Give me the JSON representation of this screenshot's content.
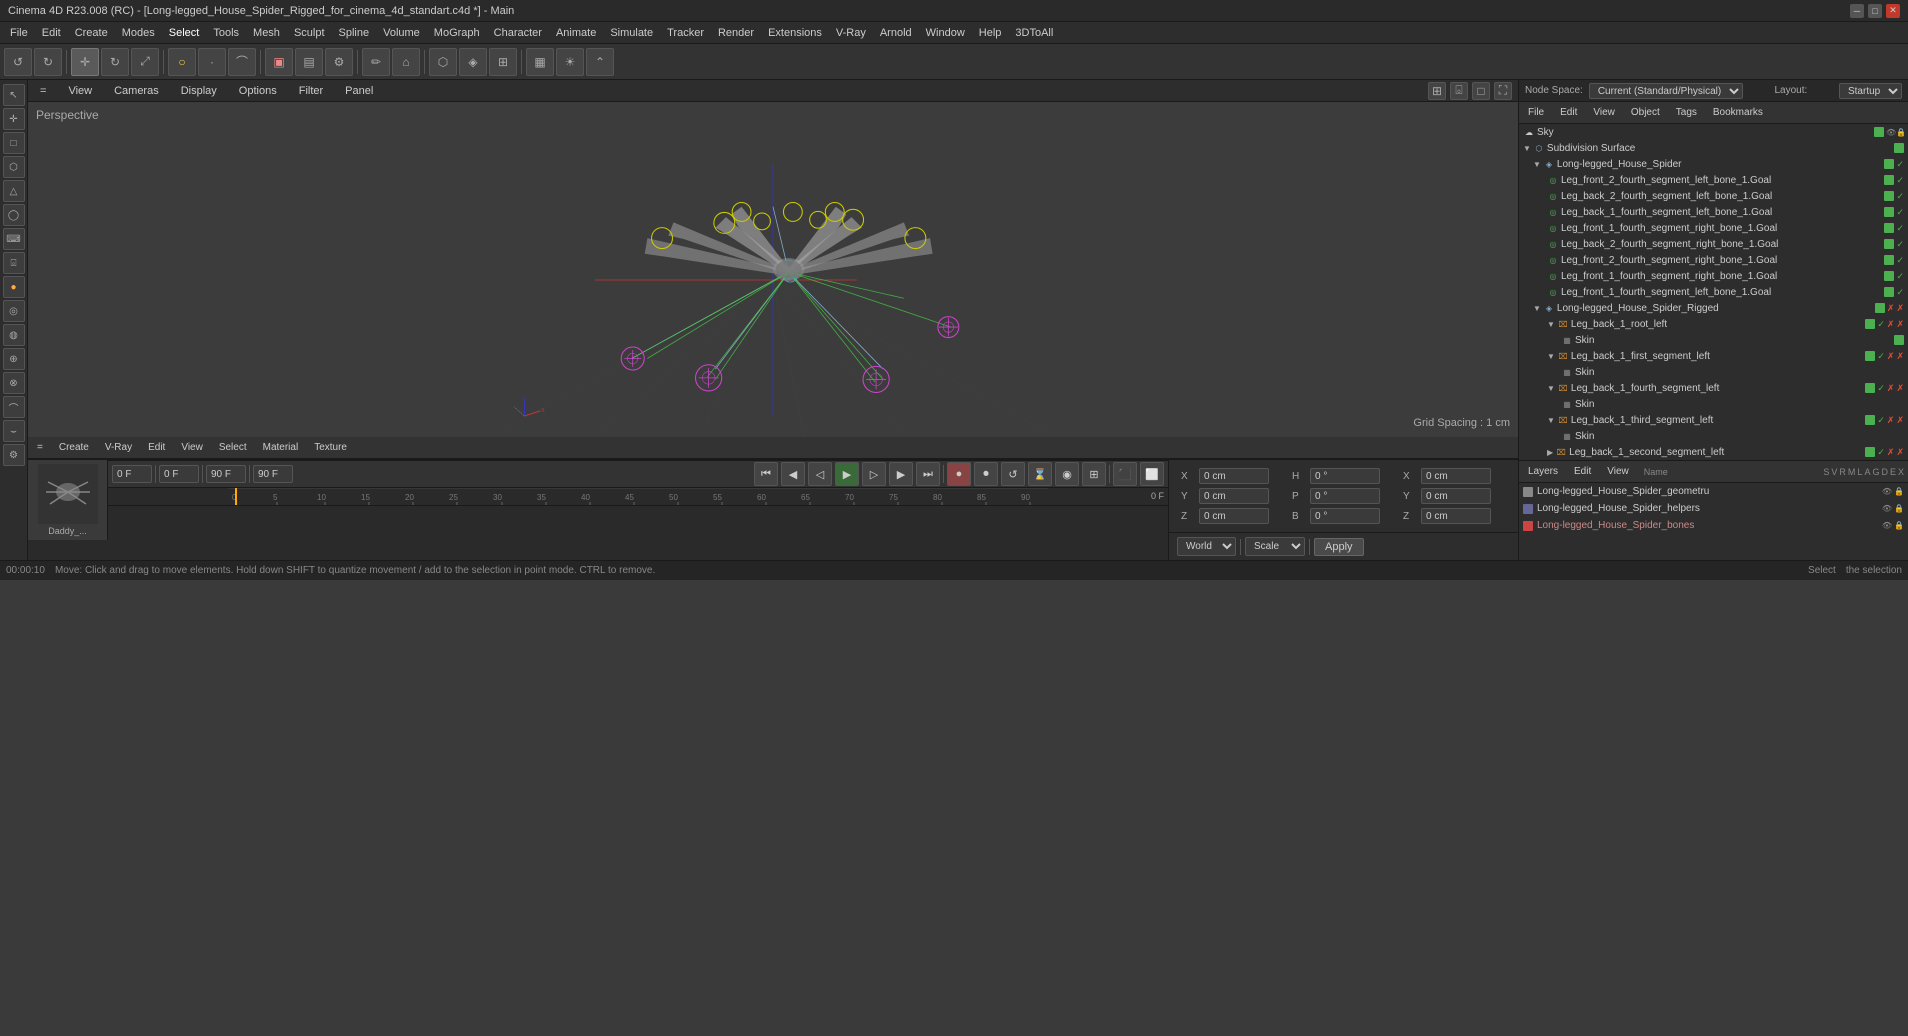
{
  "window": {
    "title": "Cinema 4D R23.008 (RC) - [Long-legged_House_Spider_Rigged_for_cinema_4d_standart.c4d *] - Main",
    "controls": [
      "─",
      "□",
      "✕"
    ]
  },
  "menu_bar": {
    "items": [
      "File",
      "Edit",
      "Create",
      "Modes",
      "Select",
      "Tools",
      "Mesh",
      "Sculpt",
      "Spline",
      "Volume",
      "MoGraph",
      "Character",
      "Animate",
      "Simulate",
      "Tracker",
      "Render",
      "Extensions",
      "V-Ray",
      "Arnold",
      "Window",
      "Help",
      "3DToAll"
    ]
  },
  "viewport": {
    "label": "Perspective",
    "grid_spacing": "Grid Spacing : 1 cm",
    "menus": [
      "=",
      "View",
      "Cameras",
      "Display",
      "Options",
      "Filter",
      "Panel"
    ]
  },
  "node_space": {
    "label": "Node Space:",
    "value": "Current (Standard/Physical)",
    "layout_label": "Layout:",
    "layout_value": "Startup"
  },
  "obj_manager": {
    "menus": [
      "File",
      "Edit",
      "View",
      "Object",
      "Tags",
      "Bookmarks"
    ],
    "items": [
      {
        "label": "Sky",
        "indent": 0,
        "type": "sky",
        "color": "#4488cc"
      },
      {
        "label": "Subdivision Surface",
        "indent": 0,
        "type": "subdiv",
        "color": "#4488cc"
      },
      {
        "label": "Long-legged_House_Spider",
        "indent": 1,
        "type": "group",
        "color": "#4488cc"
      },
      {
        "label": "Leg_front_2_fourth_segment_left_bone_1.Goal",
        "indent": 2,
        "type": "goal",
        "color": "#4caf50"
      },
      {
        "label": "Leg_back_2_fourth_segment_left_bone_1.Goal",
        "indent": 2,
        "type": "goal",
        "color": "#4caf50"
      },
      {
        "label": "Leg_back_1_fourth_segment_left_bone_1.Goal",
        "indent": 2,
        "type": "goal",
        "color": "#4caf50"
      },
      {
        "label": "Leg_front_1_fourth_segment_right_bone_1.Goal",
        "indent": 2,
        "type": "goal",
        "color": "#4caf50"
      },
      {
        "label": "Leg_back_2_fourth_segment_right_bone_1.Goal",
        "indent": 2,
        "type": "goal",
        "color": "#4caf50"
      },
      {
        "label": "Leg_front_2_fourth_segment_right_bone_1.Goal",
        "indent": 2,
        "type": "goal",
        "color": "#4caf50"
      },
      {
        "label": "Leg_front_1_fourth_segment_right_bone_1.Goal",
        "indent": 2,
        "type": "goal",
        "color": "#4caf50"
      },
      {
        "label": "Leg_front_1_fourth_segment_left_bone_1.Goal",
        "indent": 2,
        "type": "goal",
        "color": "#4caf50"
      },
      {
        "label": "Long-legged_House_Spider_Rigged",
        "indent": 1,
        "type": "group",
        "color": "#4488cc"
      },
      {
        "label": "Leg_back_1_root_left",
        "indent": 2,
        "type": "bone",
        "color": "#cc8833"
      },
      {
        "label": "Skin",
        "indent": 3,
        "type": "skin",
        "color": "#888"
      },
      {
        "label": "Leg_back_1_first_segment_left",
        "indent": 2,
        "type": "bone",
        "color": "#cc8833"
      },
      {
        "label": "Skin",
        "indent": 3,
        "type": "skin",
        "color": "#888"
      },
      {
        "label": "Leg_back_1_fourth_segment_left",
        "indent": 2,
        "type": "bone",
        "color": "#cc8833"
      },
      {
        "label": "Skin",
        "indent": 3,
        "type": "skin",
        "color": "#888"
      },
      {
        "label": "Leg_back_1_third_segment_left",
        "indent": 2,
        "type": "bone",
        "color": "#cc8833"
      },
      {
        "label": "Skin",
        "indent": 3,
        "type": "skin",
        "color": "#888"
      },
      {
        "label": "Leg_back_1_second_segment_left",
        "indent": 2,
        "type": "bone",
        "color": "#cc8833"
      }
    ]
  },
  "layer_manager": {
    "menus": [
      "Layers",
      "Edit",
      "View"
    ],
    "name_label": "Name",
    "column_labels": [
      "S",
      "V",
      "R",
      "M",
      "L",
      "A",
      "G",
      "D",
      "E",
      "X"
    ],
    "layers": [
      {
        "name": "Long-legged_House_Spider_geometru",
        "color": "#888888"
      },
      {
        "name": "Long-legged_House_Spider_helpers",
        "color": "#666699"
      },
      {
        "name": "Long-legged_House_Spider_bones",
        "color": "#cc4444"
      }
    ]
  },
  "timeline": {
    "frame_start": "0",
    "frame_end": "90 F",
    "frame_end2": "90 F",
    "current_frame": "0 F",
    "current_frame2": "0 F",
    "ruler_marks": [
      "0",
      "5",
      "10",
      "15",
      "20",
      "25",
      "30",
      "35",
      "40",
      "45",
      "50",
      "55",
      "60",
      "65",
      "70",
      "75",
      "80",
      "85",
      "90"
    ],
    "frame_display": "0 F"
  },
  "material_bar": {
    "menus": [
      "Create",
      "V-Ray",
      "Edit",
      "View",
      "Select",
      "Material",
      "Texture"
    ],
    "thumbnail_label": "Daddy_..."
  },
  "properties": {
    "coords": [
      {
        "axis": "X",
        "value": "0 cm"
      },
      {
        "axis": "Y",
        "value": "0 cm"
      },
      {
        "axis": "Z",
        "value": "0 cm"
      }
    ],
    "rotations": [
      {
        "axis": "H",
        "value": "0 °"
      },
      {
        "axis": "P",
        "value": "0 °"
      },
      {
        "axis": "B",
        "value": "0 °"
      }
    ],
    "scale": [
      {
        "axis": "X",
        "value": "0 cm"
      },
      {
        "axis": "Y",
        "value": "0 cm"
      },
      {
        "axis": "Z",
        "value": "0 cm"
      }
    ],
    "transform_space": "World",
    "transform_mode": "Scale",
    "apply_label": "Apply"
  },
  "status_bar": {
    "time": "00:00:10",
    "message": "Move: Click and drag to move elements. Hold down SHIFT to quantize movement / add to the selection in point mode. CTRL to remove.",
    "select_label": "Select",
    "select_hint": "the selection"
  }
}
